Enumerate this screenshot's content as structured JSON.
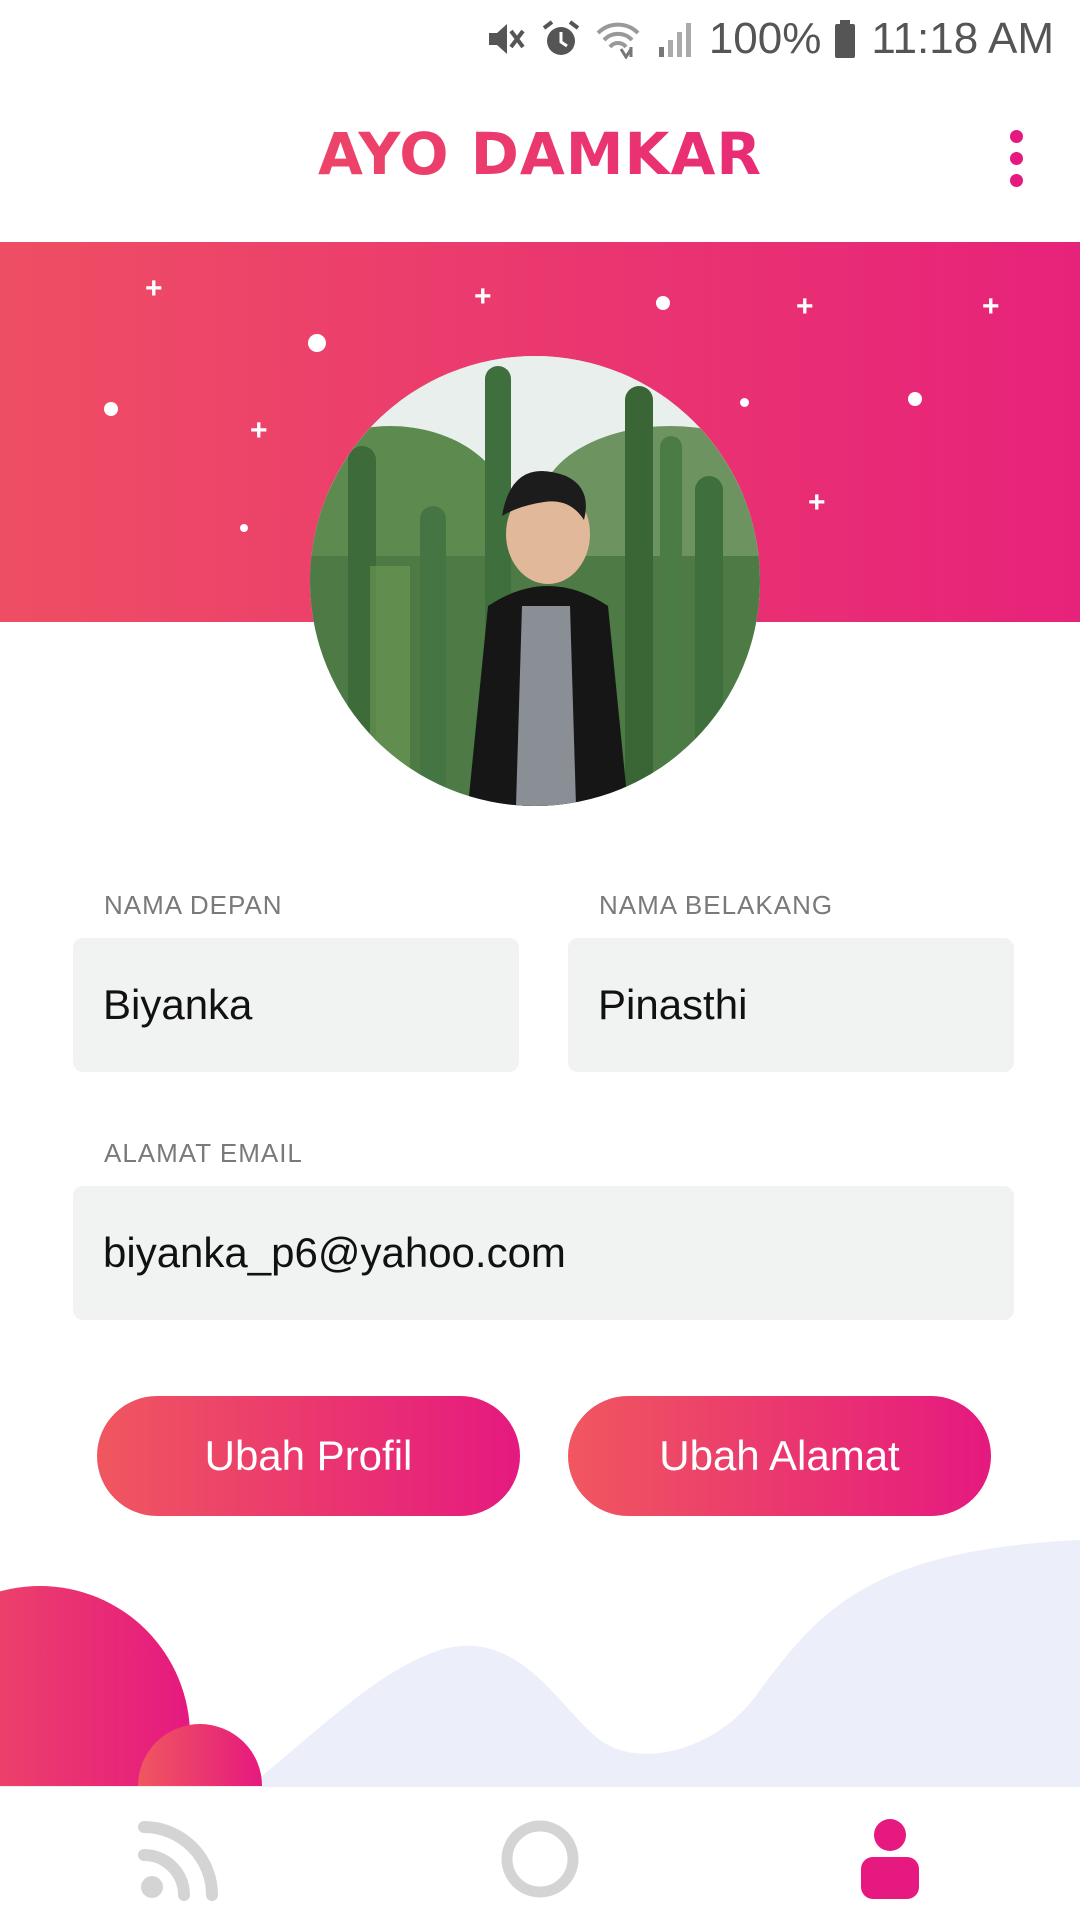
{
  "status_bar": {
    "battery": "100%",
    "time": "11:18 AM"
  },
  "app_bar": {
    "title": "AYO DAMKAR",
    "menu_icon": "more-vert-icon"
  },
  "profile": {
    "avatar_alt": "profile-photo",
    "first_name_label": "NAMA DEPAN",
    "first_name_value": "Biyanka",
    "last_name_label": "NAMA BELAKANG",
    "last_name_value": "Pinasthi",
    "email_label": "ALAMAT EMAIL",
    "email_value": "biyanka_p6@yahoo.com"
  },
  "actions": {
    "edit_profile": "Ubah Profil",
    "edit_address": "Ubah Alamat"
  },
  "bottom_nav": {
    "items": [
      {
        "icon": "feed-icon",
        "active": false
      },
      {
        "icon": "circle-icon",
        "active": false
      },
      {
        "icon": "profile-icon",
        "active": true
      }
    ]
  },
  "colors": {
    "gradient_start": "#f0575f",
    "gradient_end": "#e5197f",
    "accent": "#e5197f",
    "nav_inactive": "#d4d4d4",
    "wave": "#eceff9"
  }
}
